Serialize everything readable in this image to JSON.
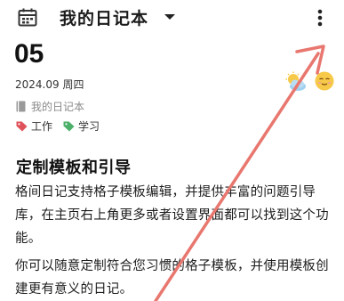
{
  "header": {
    "title": "我的日记本"
  },
  "entry": {
    "day": "05",
    "date": "2024.09 周四",
    "notebook": "我的日记本",
    "tags": [
      "工作",
      "学习"
    ],
    "heading": "定制模板和引导",
    "paragraph1": "格间日记支持格子模板编辑，并提供丰富的问题引导库，在主页右上角更多或者设置界面都可以找到这个功能。",
    "paragraph2": "你可以随意定制符合您习惯的格子模板，并使用模板创建更有意义的日记。"
  },
  "colors": {
    "tag_work": "#e0525b",
    "tag_study": "#4caf6a",
    "annotation_arrow": "#e8776f",
    "mood": "#f7c948"
  },
  "icons": {
    "calendar": "calendar-icon",
    "dropdown": "chevron-down-icon",
    "more": "more-vertical-icon",
    "weather": "partly-cloudy-icon",
    "mood": "smiley-face-icon",
    "notebook": "notebook-icon",
    "tag": "tag-icon"
  }
}
